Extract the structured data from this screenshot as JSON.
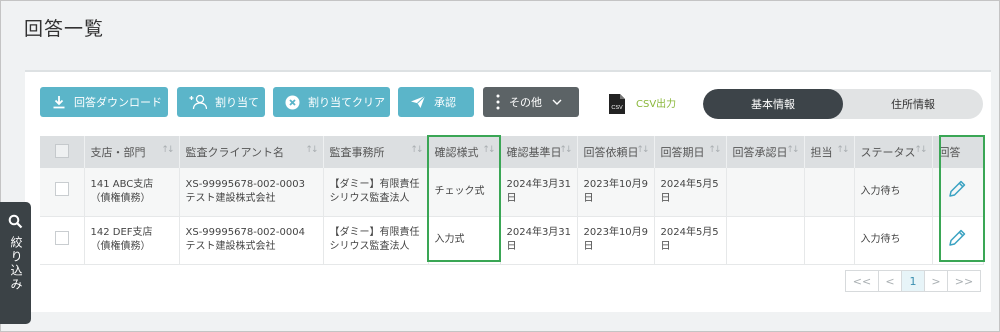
{
  "page": {
    "title": "回答一覧"
  },
  "toolbar": {
    "download": "回答ダウンロード",
    "assign": "割り当て",
    "assign_clear": "割り当てクリア",
    "approve": "承認",
    "other": "その他",
    "csv_icon_text": "CSV",
    "csv_output": "CSV出力"
  },
  "view_tabs": {
    "basic": "基本情報",
    "address": "住所情報"
  },
  "table": {
    "headers": [
      "支店・部門",
      "監査クライアント名",
      "監査事務所",
      "確認様式",
      "確認基準日",
      "回答依頼日",
      "回答期日",
      "回答承認日",
      "担当",
      "ステータス",
      "回答"
    ],
    "rows": [
      {
        "branch_line1": "141 ABC支店",
        "branch_line2": "（債権債務）",
        "client_line1": "XS-99995678-002-0003",
        "client_line2": "テスト建設株式会社",
        "firm_line1": "【ダミー】有限責任",
        "firm_line2": "シリウス監査法人",
        "format": "チェック式",
        "base_line1": "2024年3月31",
        "base_line2": "日",
        "request_line1": "2023年10月9",
        "request_line2": "日",
        "due_line1": "2024年5月5",
        "due_line2": "日",
        "approved": "",
        "assignee": "",
        "status": "入力待ち"
      },
      {
        "branch_line1": "142 DEF支店",
        "branch_line2": "（債権債務）",
        "client_line1": "XS-99995678-002-0004",
        "client_line2": "テスト建設株式会社",
        "firm_line1": "【ダミー】有限責任",
        "firm_line2": "シリウス監査法人",
        "format": "入力式",
        "base_line1": "2024年3月31",
        "base_line2": "日",
        "request_line1": "2023年10月9",
        "request_line2": "日",
        "due_line1": "2024年5月5",
        "due_line2": "日",
        "approved": "",
        "assignee": "",
        "status": "入力待ち"
      }
    ]
  },
  "pagination": {
    "first": "<<",
    "prev": "<",
    "current": "1",
    "next": ">",
    "last": ">>"
  },
  "filter_tab": {
    "label": "絞り込み"
  },
  "colors": {
    "accent": "#5bb5c9",
    "dark": "#3d4449",
    "highlight": "#3aa655",
    "csv": "#8ab73a"
  }
}
